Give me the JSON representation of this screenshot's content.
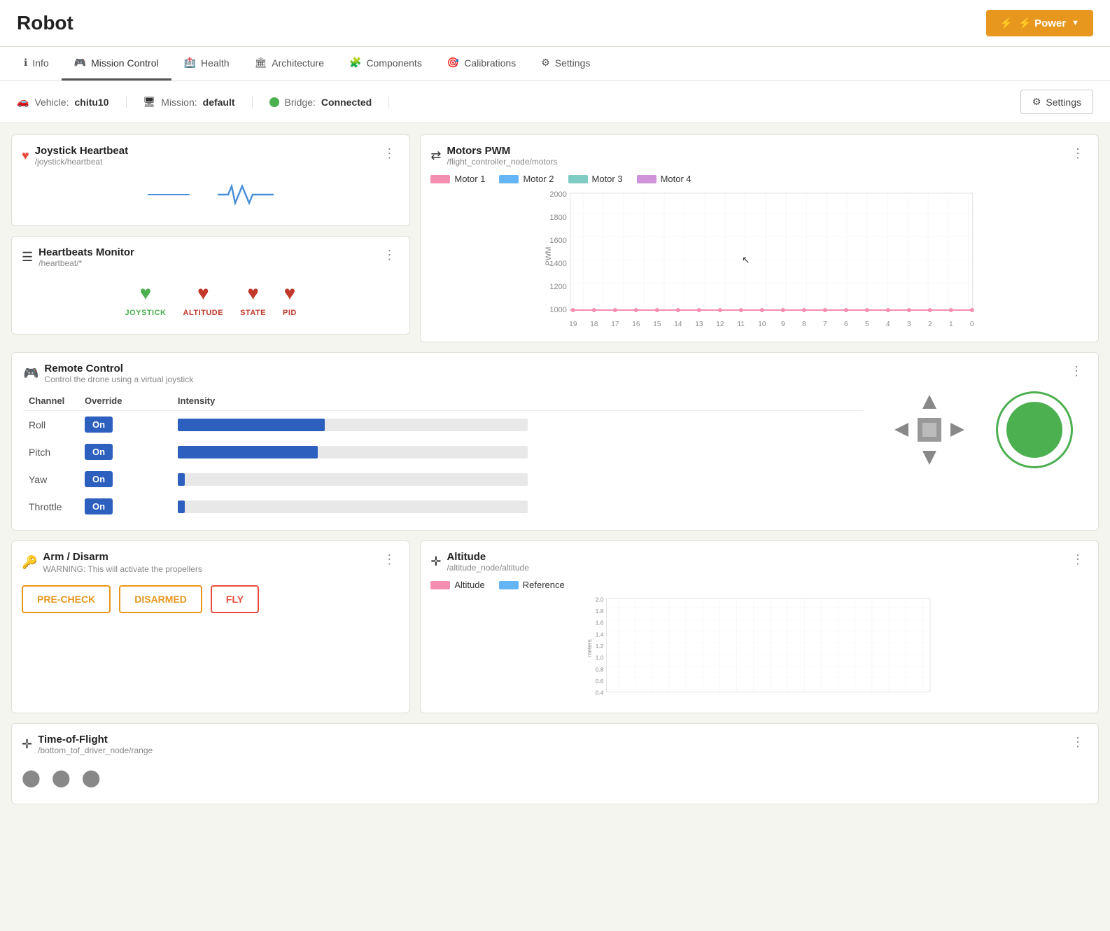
{
  "app": {
    "title": "Robot",
    "power_button": "⚡ Power"
  },
  "nav": {
    "tabs": [
      {
        "label": "Info",
        "icon": "ℹ",
        "active": false
      },
      {
        "label": "Mission Control",
        "icon": "🎯",
        "active": true
      },
      {
        "label": "Health",
        "icon": "🏥",
        "active": false
      },
      {
        "label": "Architecture",
        "icon": "🏛",
        "active": false
      },
      {
        "label": "Components",
        "icon": "🧩",
        "active": false
      },
      {
        "label": "Calibrations",
        "icon": "🎯",
        "active": false
      },
      {
        "label": "Settings",
        "icon": "⚙",
        "active": false
      }
    ]
  },
  "status": {
    "vehicle_label": "Vehicle:",
    "vehicle_value": "chitu10",
    "mission_label": "Mission:",
    "mission_value": "default",
    "bridge_label": "Bridge:",
    "bridge_value": "Connected",
    "settings_label": "Settings"
  },
  "joystick": {
    "title": "Joystick Heartbeat",
    "subtitle": "/joystick/heartbeat",
    "more": "⋮"
  },
  "heartbeats": {
    "title": "Heartbeats Monitor",
    "subtitle": "/heartbeat/*",
    "more": "⋮",
    "items": [
      {
        "label": "JOYSTICK",
        "color": "green"
      },
      {
        "label": "ALTITUDE",
        "color": "red"
      },
      {
        "label": "STATE",
        "color": "red"
      },
      {
        "label": "PID",
        "color": "red"
      }
    ]
  },
  "motors": {
    "title": "Motors PWM",
    "subtitle": "/flight_controller_node/motors",
    "more": "⋮",
    "legend": [
      {
        "label": "Motor 1",
        "color": "#f48fb1"
      },
      {
        "label": "Motor 2",
        "color": "#64b5f6"
      },
      {
        "label": "Motor 3",
        "color": "#80cbc4"
      },
      {
        "label": "Motor 4",
        "color": "#ce93d8"
      }
    ],
    "y_axis": [
      2000,
      1800,
      1600,
      1400,
      1200,
      1000
    ],
    "x_axis": [
      19,
      18,
      17,
      16,
      15,
      14,
      13,
      12,
      11,
      10,
      9,
      8,
      7,
      6,
      5,
      4,
      3,
      2,
      1,
      0
    ],
    "y_label": "PWM",
    "baseline_value": 1000
  },
  "remote_control": {
    "title": "Remote Control",
    "subtitle": "Control the drone using a virtual joystick",
    "more": "⋮",
    "col_channel": "Channel",
    "col_override": "Override",
    "col_intensity": "Intensity",
    "channels": [
      {
        "name": "Roll",
        "override": "On",
        "intensity_pct": 42
      },
      {
        "name": "Pitch",
        "override": "On",
        "intensity_pct": 40
      },
      {
        "name": "Yaw",
        "override": "On",
        "intensity_pct": 2
      },
      {
        "name": "Throttle",
        "override": "On",
        "intensity_pct": 2
      }
    ]
  },
  "arm": {
    "title": "Arm / Disarm",
    "warning": "WARNING: This will activate the propellers",
    "more": "⋮",
    "buttons": [
      {
        "label": "PRE-CHECK",
        "style": "precheck"
      },
      {
        "label": "DISARMED",
        "style": "disarmed"
      },
      {
        "label": "FLY",
        "style": "fly"
      }
    ]
  },
  "altitude": {
    "title": "Altitude",
    "subtitle": "/altitude_node/altitude",
    "more": "⋮",
    "legend": [
      {
        "label": "Altitude",
        "color": "#f48fb1"
      },
      {
        "label": "Reference",
        "color": "#64b5f6"
      }
    ],
    "y_axis": [
      2.0,
      1.8,
      1.6,
      1.4,
      1.2,
      1.0,
      0.8,
      0.6,
      0.4
    ],
    "y_label": "meters"
  },
  "tof": {
    "title": "Time-of-Flight",
    "subtitle": "/bottom_tof_driver_node/range",
    "more": "⋮"
  }
}
